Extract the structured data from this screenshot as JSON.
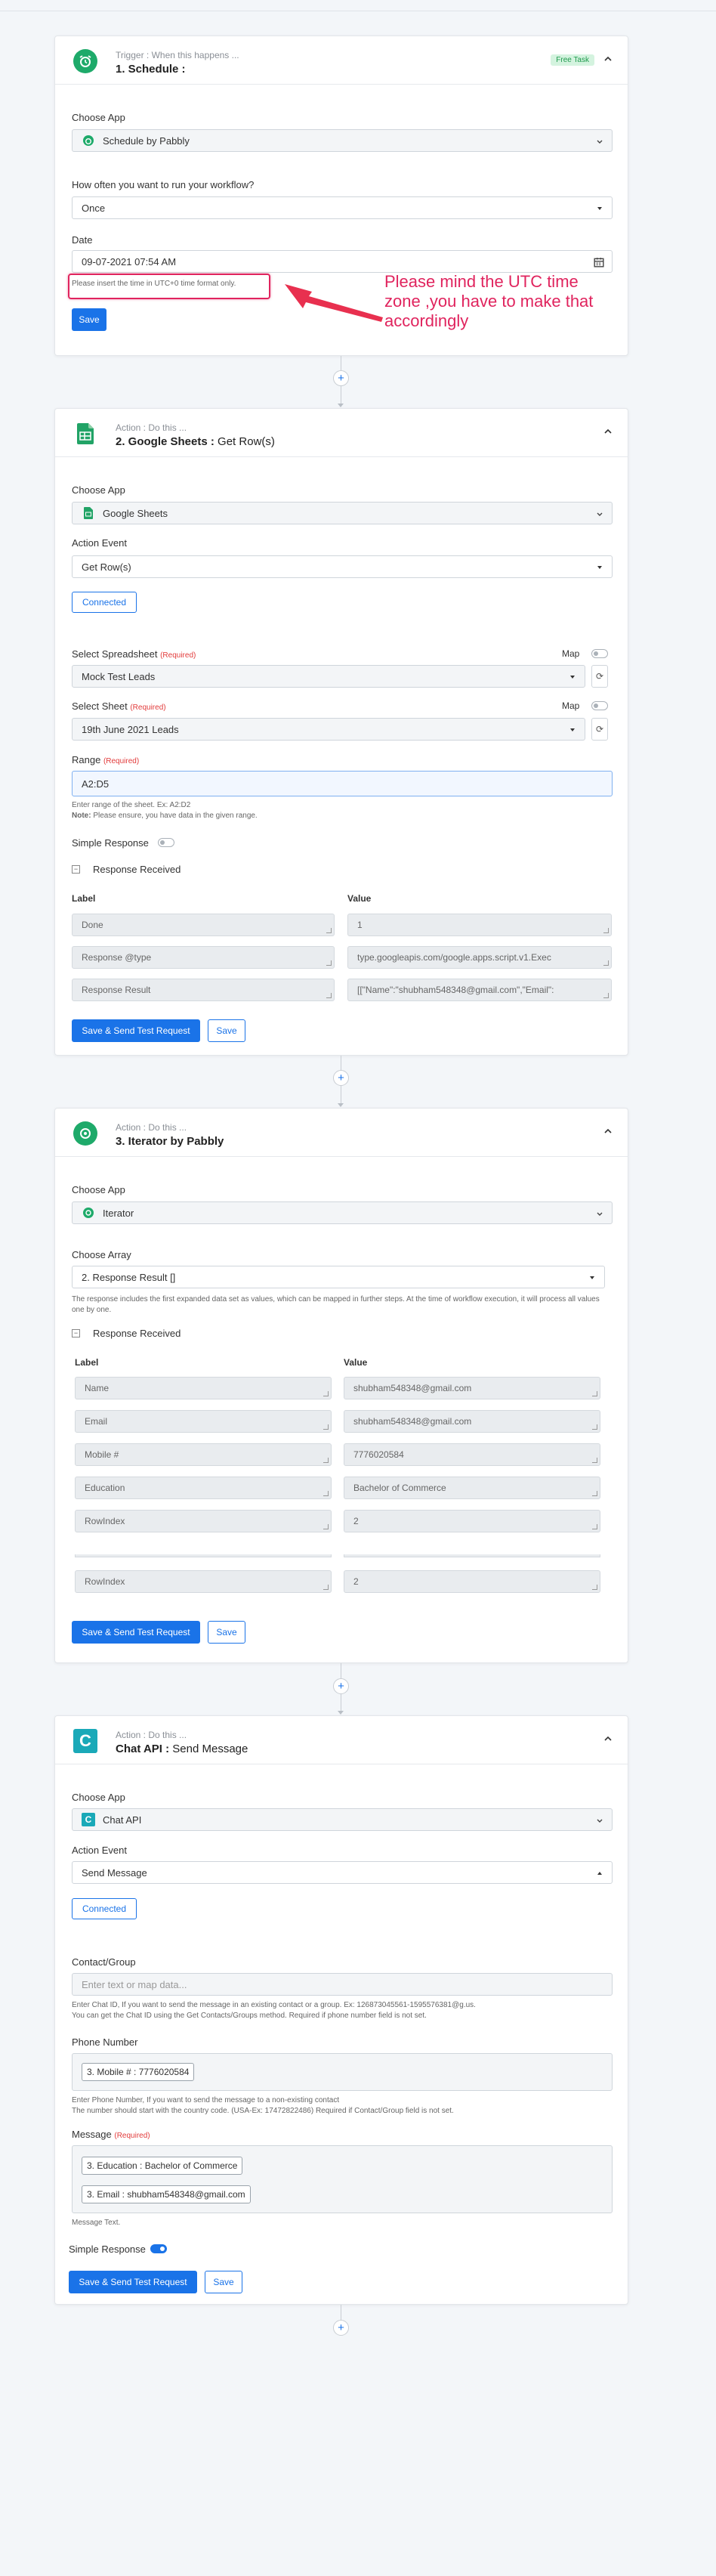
{
  "colors": {
    "primary": "#1a73e8",
    "highlight": "#e0245e",
    "annotation_text": "#e0245e"
  },
  "step1": {
    "sub": "Trigger : When this happens ...",
    "title": "1. Schedule :",
    "badge": "Free Task",
    "choose_app_label": "Choose App",
    "app": "Schedule by Pabbly",
    "freq_label": "How often you want to run your workflow?",
    "freq": "Once",
    "date_label": "Date",
    "date": "09-07-2021 07:54 AM",
    "hint": "Please insert the time in UTC+0 time format only.",
    "save": "Save",
    "annotation": "Please mind the UTC time zone ,you have to make that accordingly",
    "icons": {
      "app": "alarm-clock-icon",
      "date": "calendar-icon"
    }
  },
  "step2": {
    "sub": "Action : Do this ...",
    "title": "2. Google Sheets :",
    "title_thin": "Get Row(s)",
    "choose_app_label": "Choose App",
    "app": "Google Sheets",
    "event_label": "Action Event",
    "event": "Get Row(s)",
    "connected": "Connected",
    "spreadsheet_label": "Select Spreadsheet",
    "required": "(Required)",
    "map": "Map",
    "spreadsheet": "Mock Test Leads",
    "sheet_label": "Select Sheet",
    "sheet": "19th June 2021 Leads",
    "range_label": "Range",
    "range": "A2:D5",
    "range_hint1": "Enter range of the sheet. Ex: A2:D2",
    "range_hint2_b": "Note:",
    "range_hint2": " Please ensure, you have data in the given range.",
    "simple_response": "Simple Response",
    "response_received": "Response Received",
    "col_label": "Label",
    "col_value": "Value",
    "rows": [
      {
        "label": "Done",
        "value": "1"
      },
      {
        "label": "Response @type",
        "value": "type.googleapis.com/google.apps.script.v1.Exec"
      },
      {
        "label": "Response Result",
        "value": "[[\"Name\":\"shubham548348@gmail.com\",\"Email\":"
      }
    ],
    "save_test": "Save & Send Test Request",
    "save": "Save"
  },
  "step3": {
    "sub": "Action : Do this ...",
    "title": "3. Iterator by Pabbly",
    "choose_app_label": "Choose App",
    "app": "Iterator",
    "array_label": "Choose Array",
    "array": "2. Response Result []",
    "array_hint": "The response includes the first expanded data set as values, which can be mapped in further steps. At the time of workflow execution, it will process all values one by one.",
    "response_received": "Response Received",
    "col_label": "Label",
    "col_value": "Value",
    "rows": [
      {
        "label": "Name",
        "value": "shubham548348@gmail.com"
      },
      {
        "label": "Email",
        "value": "shubham548348@gmail.com"
      },
      {
        "label": "Mobile #",
        "value": "7776020584"
      },
      {
        "label": "Education",
        "value": "Bachelor of Commerce"
      },
      {
        "label": "RowIndex",
        "value": "2"
      }
    ],
    "last_row": {
      "label": "RowIndex",
      "value": "2"
    },
    "save_test": "Save & Send Test Request",
    "save": "Save"
  },
  "step4": {
    "sub": "Action : Do this ...",
    "title": "Chat API :",
    "title_thin": "Send Message",
    "choose_app_label": "Choose App",
    "app": "Chat API",
    "event_label": "Action Event",
    "event": "Send Message",
    "connected": "Connected",
    "contact_label": "Contact/Group",
    "contact_placeholder": "Enter text or map data...",
    "contact_hint1": "Enter Chat ID, If you want to send the message in an existing contact or a group. Ex: 12687304556​1-1595576381​@g.us.",
    "contact_hint2": "You can get the Chat ID using the Get Contacts/Groups method. Required if phone number field is not set.",
    "phone_label": "Phone Number",
    "phone_token": "3. Mobile # : 7776020584",
    "phone_hint1": "Enter Phone Number, If you want to send the message to a non-existing contact",
    "phone_hint2": "The number should start with the country code. (USA-Ex: 17472822486) Required if Contact/Group field is not set.",
    "message_label": "Message",
    "required": "(Required)",
    "msg_token1": "3. Education : Bachelor of Commerce",
    "msg_token2": "3. Email : shubham548348@gmail.com",
    "message_hint": "Message Text.",
    "simple_response": "Simple Response",
    "save_test": "Save & Send Test Request",
    "save": "Save"
  }
}
